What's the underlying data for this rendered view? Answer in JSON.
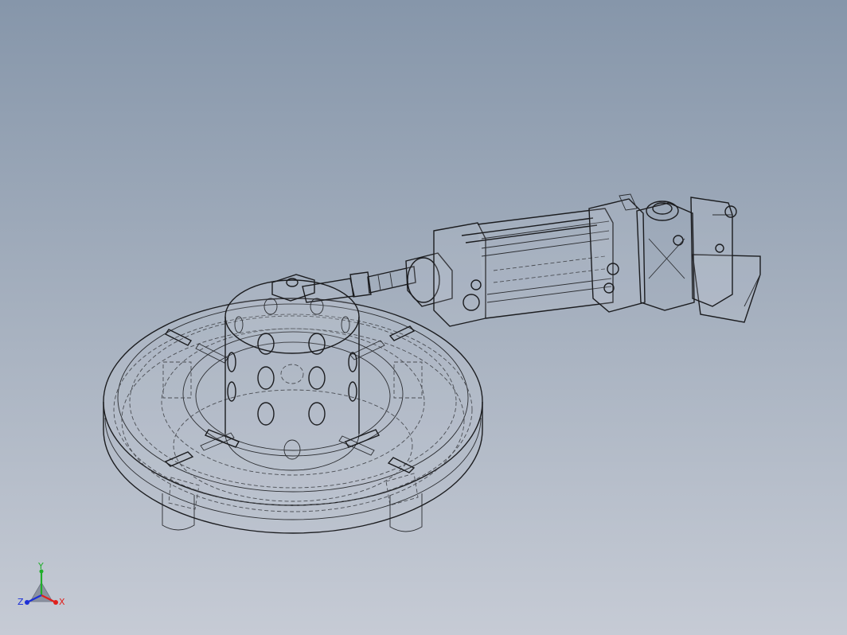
{
  "viewport": {
    "background_top": "#8696aa",
    "background_bottom": "#c6cbd5",
    "display_mode": "hidden-lines-visible"
  },
  "model": {
    "components": [
      "base-turntable",
      "perforated-cylinder",
      "pneumatic-cylinder",
      "mounting-bracket",
      "piston-rod"
    ]
  },
  "triad": {
    "x_label": "X",
    "y_label": "Y",
    "z_label": "Z",
    "x_color": "#e0201c",
    "y_color": "#1fae2a",
    "z_color": "#1c2fd6"
  }
}
